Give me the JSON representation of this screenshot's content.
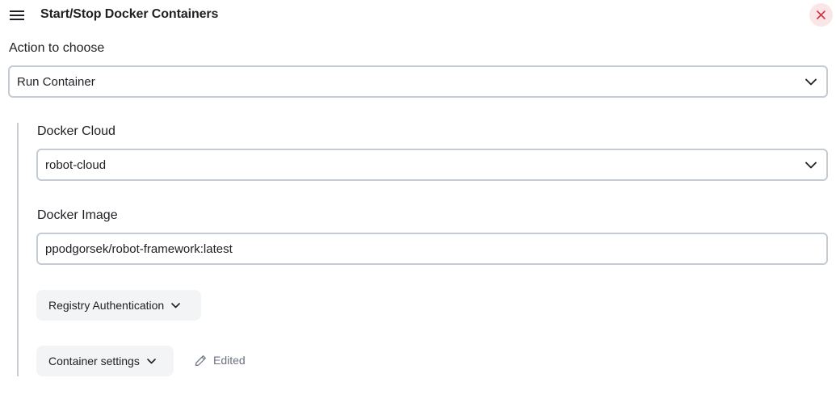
{
  "header": {
    "title": "Start/Stop Docker Containers"
  },
  "action": {
    "label": "Action to choose",
    "selected": "Run Container"
  },
  "docker_cloud": {
    "label": "Docker Cloud",
    "selected": "robot-cloud"
  },
  "docker_image": {
    "label": "Docker Image",
    "value": "ppodgorsek/robot-framework:latest"
  },
  "registry_auth": {
    "label": "Registry Authentication"
  },
  "container_settings": {
    "label": "Container settings"
  },
  "status": {
    "edited_label": "Edited"
  },
  "icons": {
    "menu": "hamburger-menu-icon",
    "close": "close-icon",
    "dropdown": "chevron-down-icon",
    "edited": "pencil-icon"
  },
  "colors": {
    "close_bg": "#fbe6e7",
    "close_x": "#d6303a",
    "border": "#c5cbd3",
    "muted": "#6b7280"
  }
}
